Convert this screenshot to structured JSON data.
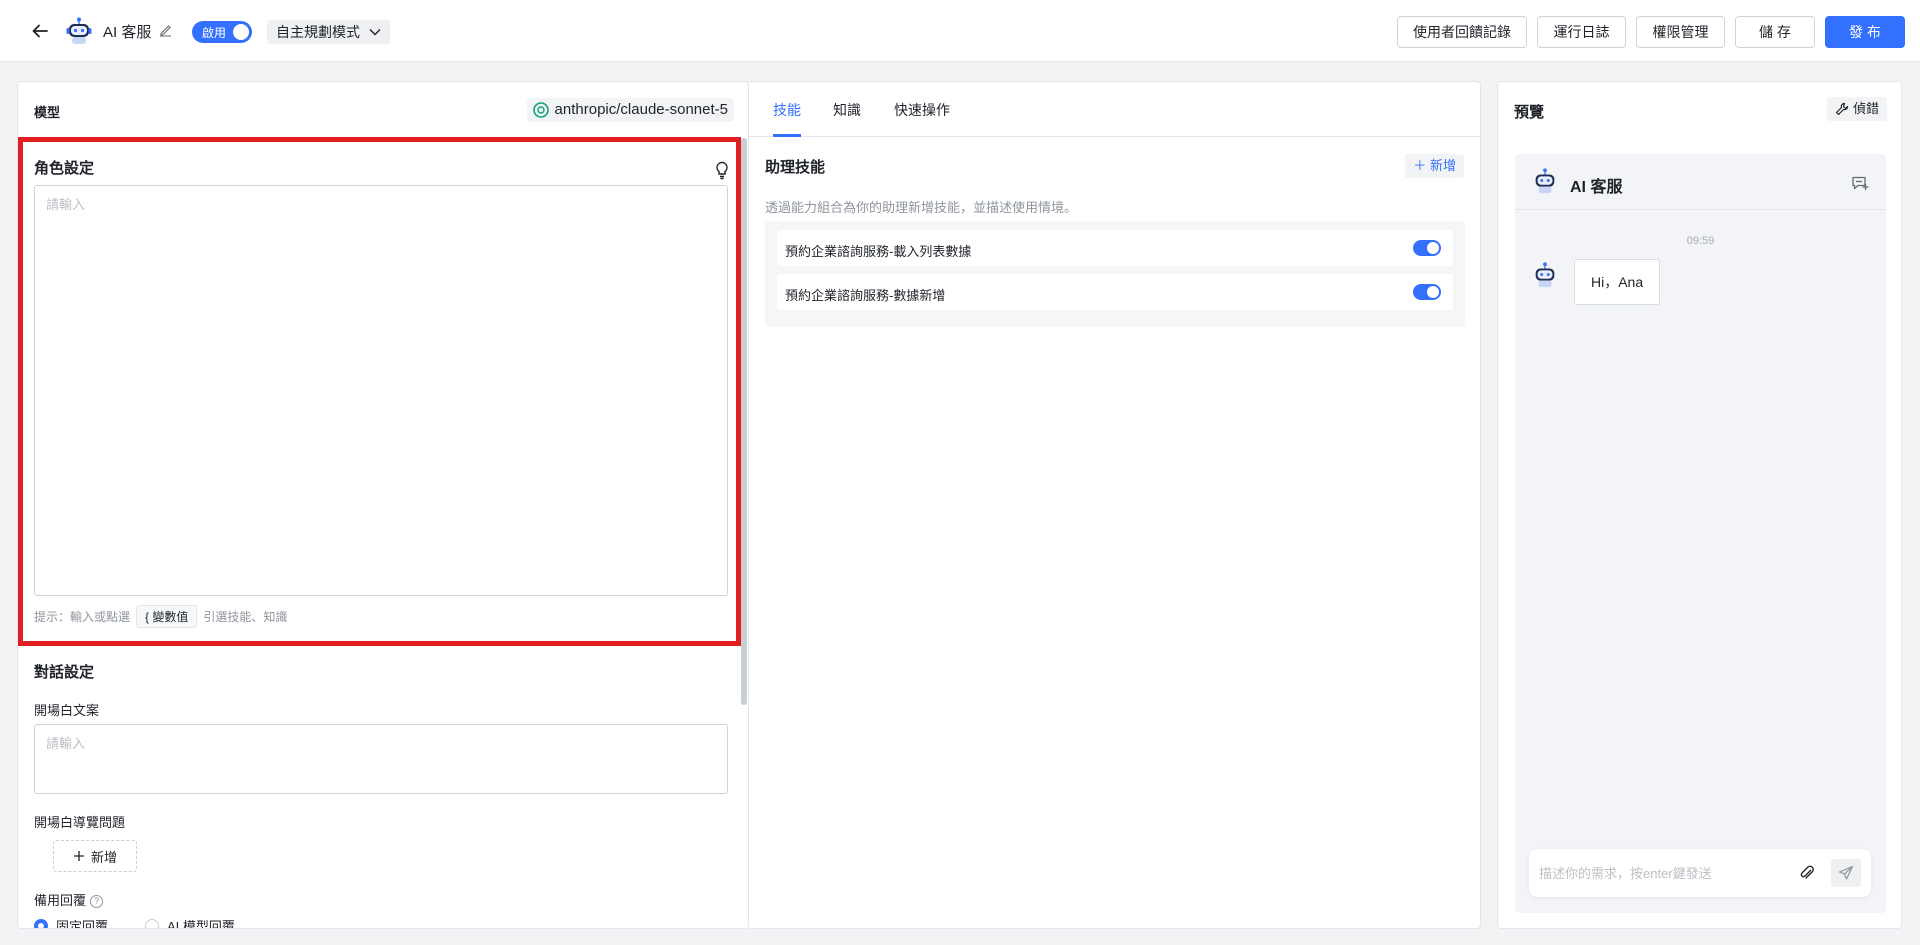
{
  "header": {
    "app_name": "AI 客服",
    "status_toggle_label": "啟用",
    "mode_select": "自主規劃模式",
    "buttons": {
      "feedback": "使用者回饋記錄",
      "logs": "運行日誌",
      "permissions": "權限管理",
      "save": "儲 存",
      "publish": "發 布"
    }
  },
  "left_panel": {
    "model_label": "模型",
    "model_name": "anthropic/claude-sonnet-5",
    "role_section_title": "角色設定",
    "role_placeholder": "請輸入",
    "hint_prefix": "提示：輸入或點選",
    "hint_chip": "{ 變數值",
    "hint_suffix": "引選技能、知識",
    "dialog_section_title": "對話設定",
    "opening_label": "開場白文案",
    "opening_placeholder": "請輸入",
    "guide_label": "開場白導覽問題",
    "add_label": "新增",
    "fallback_label": "備用回覆",
    "fallback_options": [
      "固定回覆",
      "AI 模型回覆"
    ]
  },
  "middle_panel": {
    "tabs": [
      "技能",
      "知識",
      "快速操作"
    ],
    "active_tab": 0,
    "skills_title": "助理技能",
    "add_label": "新增",
    "skills_desc": "透過能力組合為你的助理新增技能，並描述使用情境。",
    "skills": [
      {
        "name": "預約企業諮詢服務-載入列表數據",
        "enabled": true
      },
      {
        "name": "預約企業諮詢服務-數據新增",
        "enabled": true
      }
    ]
  },
  "right_panel": {
    "title": "預覽",
    "debug_label": "偵錯",
    "chat_name": "AI 客服",
    "timestamp": "09:59",
    "messages": [
      {
        "from": "bot",
        "text": "Hi，Ana"
      }
    ],
    "input_placeholder": "描述你的需求，按enter鍵發送"
  },
  "colors": {
    "accent": "#3370ff",
    "highlight_border": "#e02020"
  },
  "icons": [
    "back-arrow-icon",
    "robot-icon",
    "pencil-icon",
    "chevron-down-icon",
    "model-logo-icon",
    "lightbulb-icon",
    "plus-icon",
    "help-icon",
    "wrench-icon",
    "new-chat-icon",
    "paperclip-icon",
    "send-icon"
  ]
}
